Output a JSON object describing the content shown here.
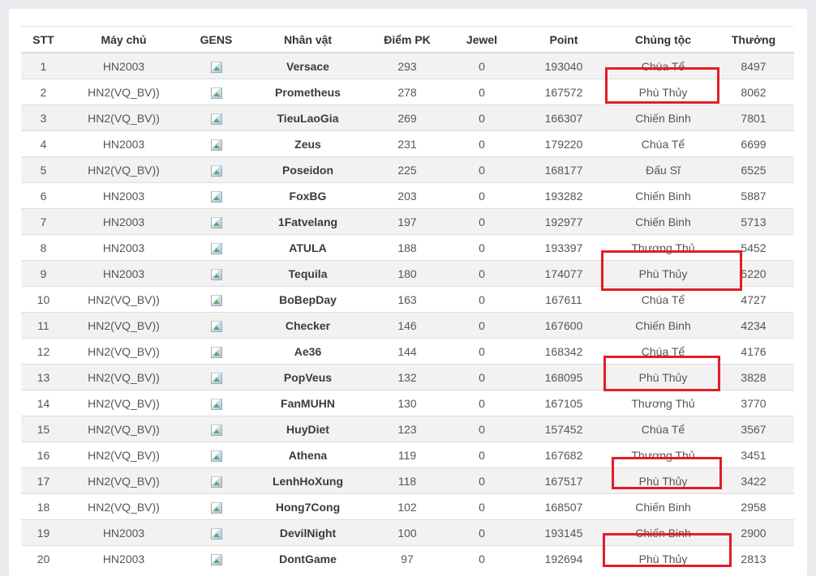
{
  "table": {
    "headers": {
      "stt": "STT",
      "server": "Máy chủ",
      "gens": "GENS",
      "character": "Nhân vật",
      "pk": "Điểm PK",
      "jewel": "Jewel",
      "point": "Point",
      "race": "Chủng tộc",
      "reward": "Thưởng"
    },
    "rows": [
      {
        "stt": "1",
        "server": "HN2003",
        "name": "Versace",
        "pk": "293",
        "jewel": "0",
        "point": "193040",
        "race": "Chúa Tể",
        "reward": "8497"
      },
      {
        "stt": "2",
        "server": "HN2(VQ_BV))",
        "name": "Prometheus",
        "pk": "278",
        "jewel": "0",
        "point": "167572",
        "race": "Phù Thủy",
        "reward": "8062"
      },
      {
        "stt": "3",
        "server": "HN2(VQ_BV))",
        "name": "TieuLaoGia",
        "pk": "269",
        "jewel": "0",
        "point": "166307",
        "race": "Chiến Binh",
        "reward": "7801"
      },
      {
        "stt": "4",
        "server": "HN2003",
        "name": "Zeus",
        "pk": "231",
        "jewel": "0",
        "point": "179220",
        "race": "Chúa Tể",
        "reward": "6699"
      },
      {
        "stt": "5",
        "server": "HN2(VQ_BV))",
        "name": "Poseidon",
        "pk": "225",
        "jewel": "0",
        "point": "168177",
        "race": "Đấu Sĩ",
        "reward": "6525"
      },
      {
        "stt": "6",
        "server": "HN2003",
        "name": "FoxBG",
        "pk": "203",
        "jewel": "0",
        "point": "193282",
        "race": "Chiến Binh",
        "reward": "5887"
      },
      {
        "stt": "7",
        "server": "HN2003",
        "name": "1Fatvelang",
        "pk": "197",
        "jewel": "0",
        "point": "192977",
        "race": "Chiến Binh",
        "reward": "5713"
      },
      {
        "stt": "8",
        "server": "HN2003",
        "name": "ATULA",
        "pk": "188",
        "jewel": "0",
        "point": "193397",
        "race": "Thương Thủ",
        "reward": "5452"
      },
      {
        "stt": "9",
        "server": "HN2003",
        "name": "Tequila",
        "pk": "180",
        "jewel": "0",
        "point": "174077",
        "race": "Phù Thủy",
        "reward": "5220"
      },
      {
        "stt": "10",
        "server": "HN2(VQ_BV))",
        "name": "BoBepDay",
        "pk": "163",
        "jewel": "0",
        "point": "167611",
        "race": "Chúa Tể",
        "reward": "4727"
      },
      {
        "stt": "11",
        "server": "HN2(VQ_BV))",
        "name": "Checker",
        "pk": "146",
        "jewel": "0",
        "point": "167600",
        "race": "Chiến Binh",
        "reward": "4234"
      },
      {
        "stt": "12",
        "server": "HN2(VQ_BV))",
        "name": "Ae36",
        "pk": "144",
        "jewel": "0",
        "point": "168342",
        "race": "Chúa Tể",
        "reward": "4176"
      },
      {
        "stt": "13",
        "server": "HN2(VQ_BV))",
        "name": "PopVeus",
        "pk": "132",
        "jewel": "0",
        "point": "168095",
        "race": "Phù Thủy",
        "reward": "3828"
      },
      {
        "stt": "14",
        "server": "HN2(VQ_BV))",
        "name": "FanMUHN",
        "pk": "130",
        "jewel": "0",
        "point": "167105",
        "race": "Thương Thủ",
        "reward": "3770"
      },
      {
        "stt": "15",
        "server": "HN2(VQ_BV))",
        "name": "HuyDiet",
        "pk": "123",
        "jewel": "0",
        "point": "157452",
        "race": "Chúa Tể",
        "reward": "3567"
      },
      {
        "stt": "16",
        "server": "HN2(VQ_BV))",
        "name": "Athena",
        "pk": "119",
        "jewel": "0",
        "point": "167682",
        "race": "Thương Thủ",
        "reward": "3451"
      },
      {
        "stt": "17",
        "server": "HN2(VQ_BV))",
        "name": "LenhHoXung",
        "pk": "118",
        "jewel": "0",
        "point": "167517",
        "race": "Phù Thủy",
        "reward": "3422"
      },
      {
        "stt": "18",
        "server": "HN2(VQ_BV))",
        "name": "Hong7Cong",
        "pk": "102",
        "jewel": "0",
        "point": "168507",
        "race": "Chiến Binh",
        "reward": "2958"
      },
      {
        "stt": "19",
        "server": "HN2003",
        "name": "DevilNight",
        "pk": "100",
        "jewel": "0",
        "point": "193145",
        "race": "Chiến Binh",
        "reward": "2900"
      },
      {
        "stt": "20",
        "server": "HN2003",
        "name": "DontGame",
        "pk": "97",
        "jewel": "0",
        "point": "192694",
        "race": "Phù Thủy",
        "reward": "2813"
      }
    ]
  },
  "icons": {
    "gens": "broken-image-icon"
  },
  "colors": {
    "highlight": "#e11d2a",
    "stripe": "#f2f2f2"
  }
}
